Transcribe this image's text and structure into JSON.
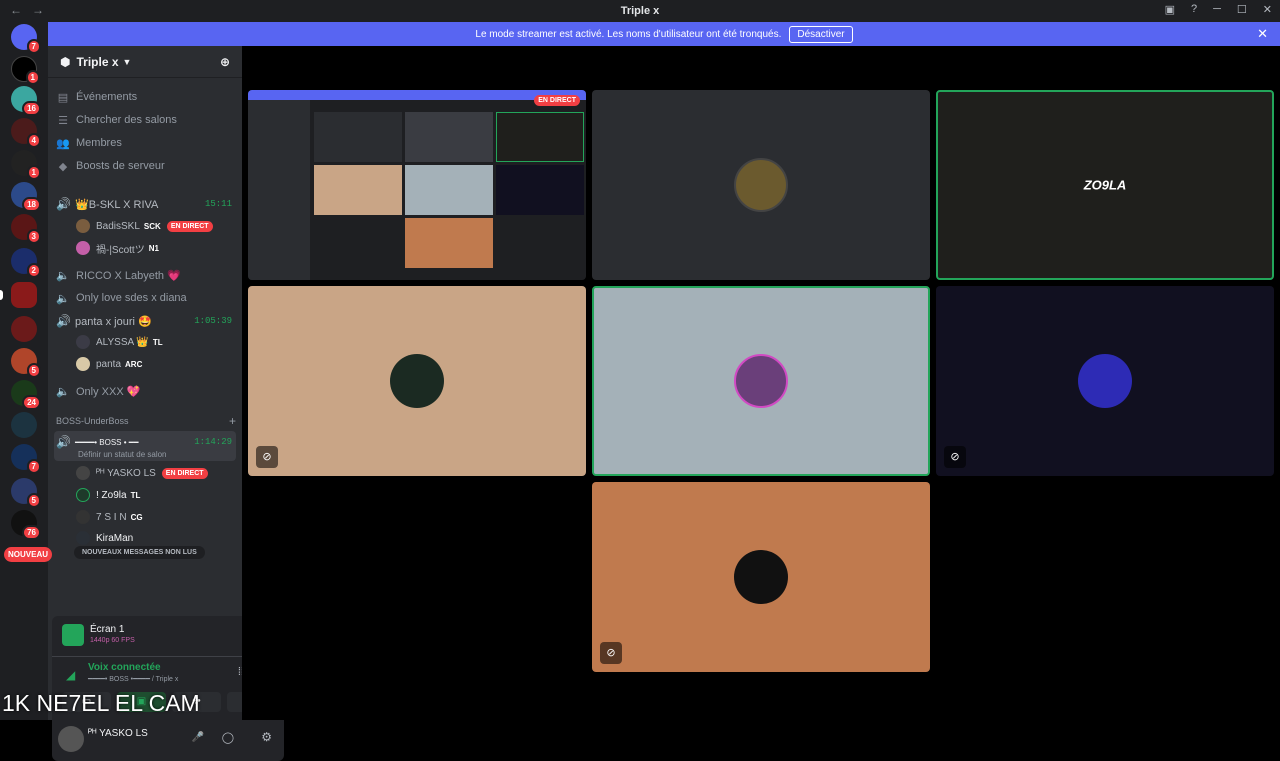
{
  "window": {
    "title": "Triple x"
  },
  "banner": {
    "text": "Le mode streamer est activé. Les noms d'utilisateur ont été tronqués.",
    "button": "Désactiver"
  },
  "servers": [
    {
      "badge": "7"
    },
    {
      "badge": "1"
    },
    {
      "badge": "16"
    },
    {
      "badge": "4"
    },
    {
      "badge": "1"
    },
    {
      "badge": "18"
    },
    {
      "badge": "3"
    },
    {
      "badge": "2"
    },
    {
      "badge": ""
    },
    {
      "badge": ""
    },
    {
      "badge": "5"
    },
    {
      "badge": "24"
    },
    {
      "badge": ""
    },
    {
      "badge": "7"
    },
    {
      "badge": "5"
    },
    {
      "badge": "76"
    }
  ],
  "new_badge": "NOUVEAU",
  "guild": {
    "name": "Triple x"
  },
  "menu": [
    "Événements",
    "Chercher des salons",
    "Membres",
    "Boosts de serveur"
  ],
  "channels": {
    "c1": {
      "name": "👑B-SKL X RIVA",
      "time": "15:11"
    },
    "c1_users": [
      {
        "name": "BadisSKL",
        "tag": "SCK",
        "live": "EN DIRECT"
      },
      {
        "name": "禍-|Scottツ",
        "tag": "N1"
      }
    ],
    "c2": "RICCO X Labyeth 💗",
    "c3": "Only love sdes x diana",
    "c4": {
      "name": "panta x jouri 🤩",
      "time": "1:05:39"
    },
    "c4_users": [
      {
        "name": "ALYSSA 👑",
        "tag": "TL"
      },
      {
        "name": "panta",
        "tag": "ARC"
      }
    ],
    "c5": "Only XXX 💖",
    "category": "BOSS-UnderBoss",
    "c6": {
      "name": "━━━━• BOSS • ━━",
      "time": "1:14:29",
      "status": "Définir un statut de salon"
    },
    "c6_users": [
      {
        "name": "ᴾᴴ YASKO LS",
        "live": "EN DIRECT"
      },
      {
        "name": "! Zo9la",
        "tag": "TL"
      },
      {
        "name": "7 S I N",
        "tag": "CG"
      },
      {
        "name": "KiraMan"
      }
    ],
    "unread": "NOUVEAUX MESSAGES NON LUS"
  },
  "stream_panel": {
    "title": "Écran 1",
    "quality": "1440p 60 FPS"
  },
  "voice": {
    "status": "Voix connectée",
    "channel": "━━━━• BOSS •━━━━ / Triple x"
  },
  "user": {
    "name": "ᴾᴴ YASKO LS"
  },
  "overlay": "1K NE7EL EL CAM",
  "live_label": "EN DIRECT",
  "tiles": [
    {
      "id": "screen",
      "color": "#111214",
      "label": "EN DIRECT"
    },
    {
      "id": "t2",
      "color": "#2b2d31"
    },
    {
      "id": "t3",
      "color": "#1f1f1c",
      "avatar_text": "ZO9LA"
    },
    {
      "id": "t4",
      "color": "#c9a586"
    },
    {
      "id": "t5",
      "color": "#a4b1b8"
    },
    {
      "id": "t6",
      "color": "#111020"
    },
    {
      "id": "t7",
      "color": "#c07a4e"
    }
  ]
}
